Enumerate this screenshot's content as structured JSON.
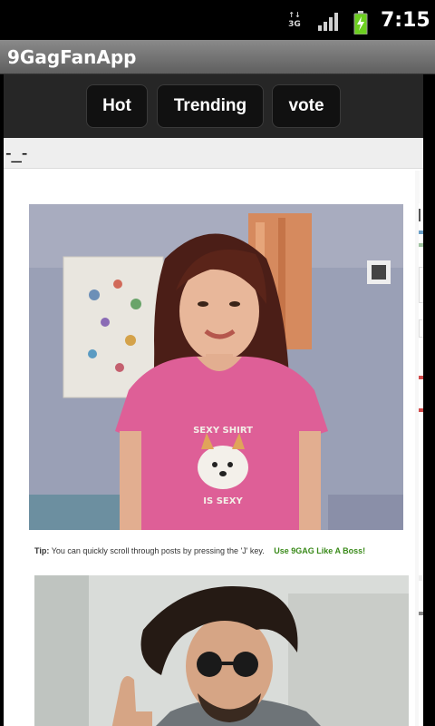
{
  "status_bar": {
    "time": "7:15",
    "network": "3G",
    "icons": [
      "3g-icon",
      "signal-icon",
      "battery-charging-icon"
    ]
  },
  "app": {
    "title": "9GagFanApp"
  },
  "buttons": [
    {
      "label": "Hot"
    },
    {
      "label": "Trending"
    },
    {
      "label": "vote"
    }
  ],
  "content": {
    "face_text": "-_-",
    "tip": {
      "label": "Tip:",
      "text": "You can quickly scroll through posts by pressing the 'J' key.",
      "link": "Use 9GAG Like A Boss!"
    },
    "shirt_text_top": "SEXY SHIRT",
    "shirt_text_bottom": "IS SEXY"
  },
  "colors": {
    "button_bar": "#262626",
    "title_bar": "#6e6e6e",
    "link_green": "#3a8a1a"
  }
}
